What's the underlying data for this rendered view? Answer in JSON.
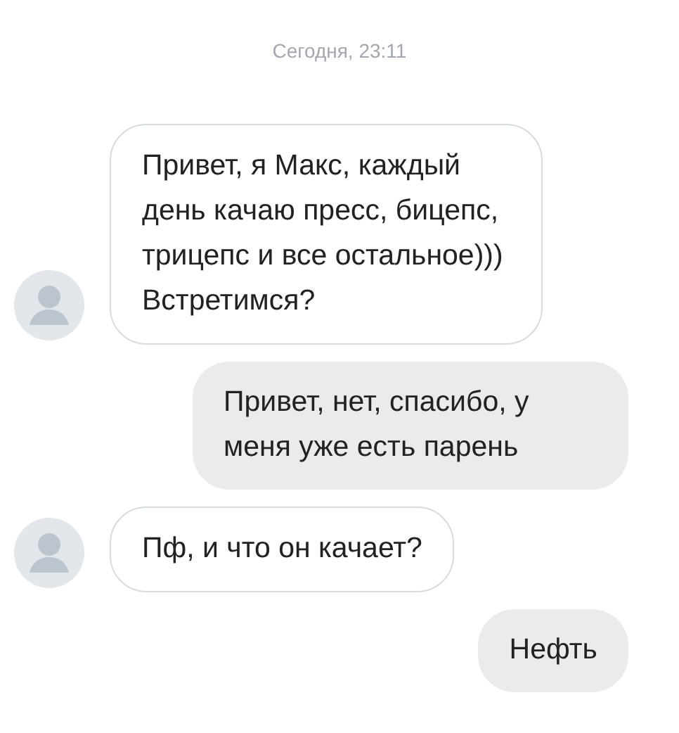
{
  "date_label": "Сегодня, 23:11",
  "messages": [
    {
      "kind": "incoming",
      "text": "Привет, я Макс, каждый день качаю пресс, бицепс, трицепс и все остальное))) Встретимся?"
    },
    {
      "kind": "outgoing",
      "text": "Привет, нет, спасибо, у меня уже есть парень"
    },
    {
      "kind": "incoming",
      "text": "Пф, и что он качает?"
    },
    {
      "kind": "outgoing",
      "text": "Нефть"
    }
  ]
}
